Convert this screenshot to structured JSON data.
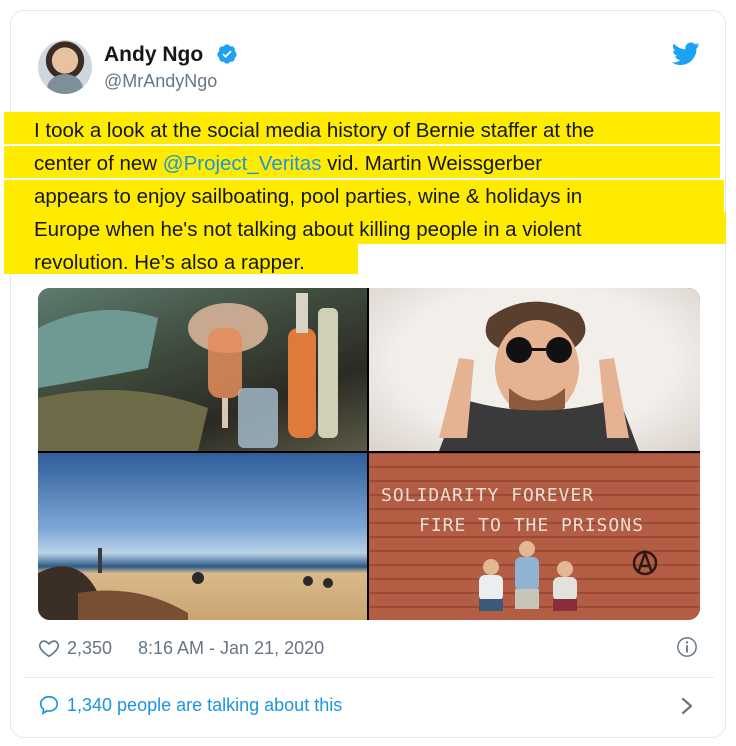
{
  "author": {
    "name": "Andy Ngo",
    "handle": "@MrAndyNgo",
    "avatar_icon": "user-avatar",
    "verified_icon": "verified-badge-icon"
  },
  "platform_icon": "twitter-bird-icon",
  "tweet": {
    "line1": "I took a look at the social media history of Bernie staffer at the",
    "line2_pre": "center of new ",
    "mention": "@Project_Veritas",
    "line2_post": " vid. Martin Weissgerber",
    "line3": "appears to enjoy sailboating, pool parties, wine & holidays in",
    "line4": "Europe when he's not talking about killing people in a violent",
    "line5": "revolution. He’s also a rapper.",
    "highlight_color": "#ffeb00",
    "mention_color": "#1b95e0"
  },
  "media": {
    "graffiti_line1": "SOLIDARITY FOREVER",
    "graffiti_line2": "FIRE TO THE PRISONS"
  },
  "footer": {
    "likes": "2,350",
    "timestamp": "8:16 AM - Jan 21, 2020",
    "talking": "1,340 people are talking about this",
    "heart_icon": "heart-icon",
    "info_icon": "info-icon",
    "comment_icon": "comment-bubble-icon",
    "chevron_icon": "chevron-right-icon"
  }
}
